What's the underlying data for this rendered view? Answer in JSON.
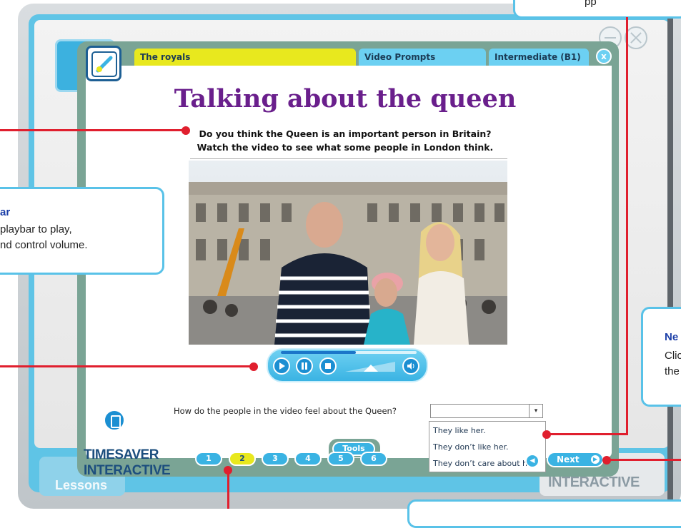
{
  "background": {
    "lessons_label": "Lessons",
    "brand_partial": "INTERACTIVE"
  },
  "header": {
    "topic": "The royals",
    "type": "Video Prompts",
    "level": "Intermediate (B1)",
    "close_label": "x"
  },
  "page": {
    "title": "Talking about the queen",
    "intro_line1": "Do you think the Queen is an important person in Britain?",
    "intro_line2": "Watch the video to see what some people in London think."
  },
  "video": {
    "progress": 0.55
  },
  "question": {
    "text": "How do the people in the video feel about the Queen?",
    "selected": "",
    "options": [
      "They like her.",
      "They don’t like her.",
      "They don’t care about her."
    ]
  },
  "tools_label": "Tools",
  "brand": {
    "line1": "TIMESAVER",
    "line2": "INTERACTIVE"
  },
  "pagination": {
    "pages": [
      "1",
      "2",
      "3",
      "4",
      "5",
      "6"
    ],
    "current": "2",
    "next_label": "Next"
  },
  "callouts": {
    "top_text": "pp",
    "playbar_title": "ar",
    "playbar_body_line1": "playbar to play,",
    "playbar_body_line2": "nd control volume.",
    "next_title": "Ne",
    "next_body_line1": "Clic",
    "next_body_line2": "the"
  },
  "colors": {
    "accent_blue": "#3ab3e3",
    "title_purple": "#6a1f8c",
    "highlight_yellow": "#e8e81e",
    "callout_red": "#e01f2e"
  }
}
